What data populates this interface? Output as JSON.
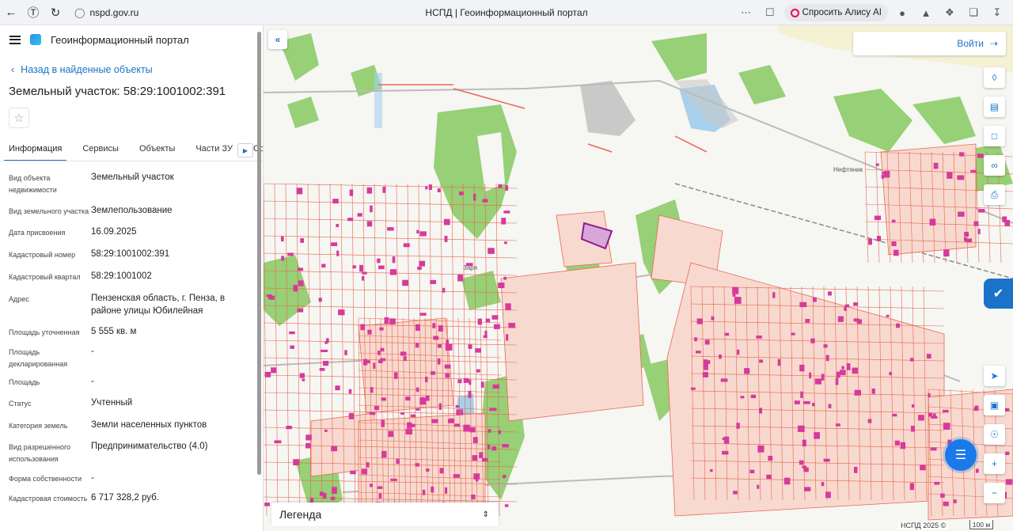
{
  "browser": {
    "url": "nspd.gov.ru",
    "tab_title": "НСПД | Геоинформационный портал",
    "alice_label": "Спросить Алису AI"
  },
  "header": {
    "app_title": "Геоинформационный портал"
  },
  "panel": {
    "back_link": "Назад в найденные объекты",
    "title": "Земельный участок: 58:29:1001002:391",
    "tabs": [
      {
        "label": "Информация",
        "active": true
      },
      {
        "label": "Сервисы",
        "active": false
      },
      {
        "label": "Объекты",
        "active": false
      },
      {
        "label": "Части ЗУ",
        "active": false
      },
      {
        "label": "Соста",
        "active": false
      }
    ],
    "properties": [
      {
        "key": "Вид объекта недвижимости",
        "value": "Земельный участок"
      },
      {
        "key": "Вид земельного участка",
        "value": "Землепользование"
      },
      {
        "key": "Дата присвоения",
        "value": "16.09.2025"
      },
      {
        "key": "Кадастровый номер",
        "value": "58:29:1001002:391"
      },
      {
        "key": "Кадастровый квартал",
        "value": "58:29:1001002"
      },
      {
        "key": "Адрес",
        "value": "Пензенская область, г. Пенза, в районе улицы Юбилейная"
      },
      {
        "key": "Площадь уточненная",
        "value": "5 555 кв. м"
      },
      {
        "key": "Площадь декларированная",
        "value": "-"
      },
      {
        "key": "Площадь",
        "value": "-"
      },
      {
        "key": "Статус",
        "value": "Учтенный"
      },
      {
        "key": "Категория земель",
        "value": "Земли населенных пунктов"
      },
      {
        "key": "Вид разрешенного использования",
        "value": "Предпринимательство (4.0)"
      },
      {
        "key": "Форма собственности",
        "value": "-"
      },
      {
        "key": "Кадастровая стоимость",
        "value": "6 717 328,2 руб."
      }
    ]
  },
  "map": {
    "login_label": "Войти",
    "legend_label": "Легенда",
    "copyright": "НСПД 2025 ©",
    "scale_label": "100 м",
    "place_labels": [
      "Нефтяник",
      "Заря"
    ],
    "colors": {
      "parcel_line": "#e9674f",
      "parcel_fill": "#f7d9cf",
      "building": "#d63a9c",
      "greenery": "#8fcf6a",
      "water": "#a9d0ea",
      "selected": "#8a1e8a",
      "accent": "#1a73c8"
    }
  }
}
